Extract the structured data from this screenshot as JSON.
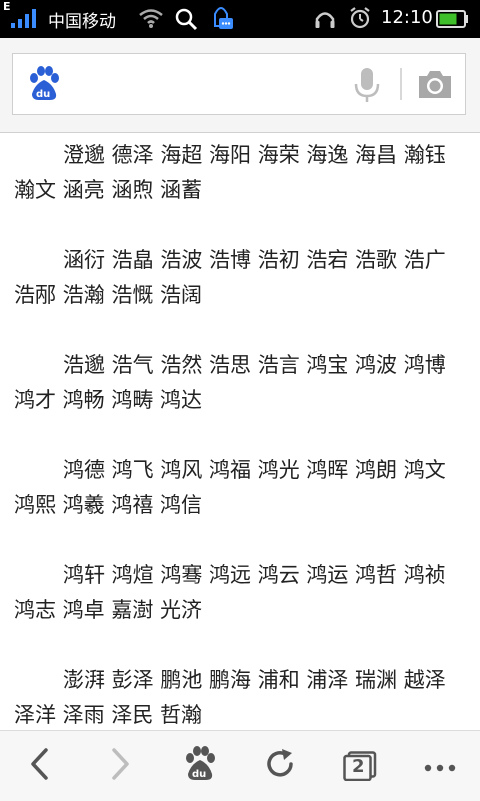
{
  "status_bar": {
    "network_type": "E",
    "carrier": "中国移动",
    "time": "12:10"
  },
  "search": {
    "value": ""
  },
  "content": {
    "paragraphs": [
      "澄邈 德泽 海超 海阳 海荣 海逸 海昌 瀚钰 瀚文 涵亮 涵煦 涵蓄",
      "涵衍 浩皛 浩波 浩博 浩初 浩宕 浩歌 浩广 浩邴 浩瀚 浩慨 浩阔",
      "浩邈 浩气 浩然 浩思 浩言 鸿宝 鸿波 鸿博 鸿才 鸿畅 鸿畴 鸿达",
      "鸿德 鸿飞 鸿风 鸿福 鸿光 鸿晖 鸿朗 鸿文 鸿熙 鸿羲 鸿禧 鸿信",
      "鸿轩 鸿煊 鸿骞 鸿远 鸿云 鸿运 鸿哲 鸿祯 鸿志 鸿卓 嘉澍 光济",
      "澎湃 彭泽 鹏池 鹏海 浦和 浦泽 瑞渊 越泽 泽洋 泽雨 泽民 哲瀚"
    ]
  },
  "toolbar": {
    "tab_count": "2",
    "icons": [
      "back-icon",
      "forward-icon",
      "baidu-paw-icon",
      "refresh-icon",
      "tabs-icon",
      "more-icon"
    ]
  },
  "colors": {
    "status_bar_bg": "#000000",
    "baidu_blue": "#2a5fd6",
    "battery_green": "#3fbf2a"
  }
}
